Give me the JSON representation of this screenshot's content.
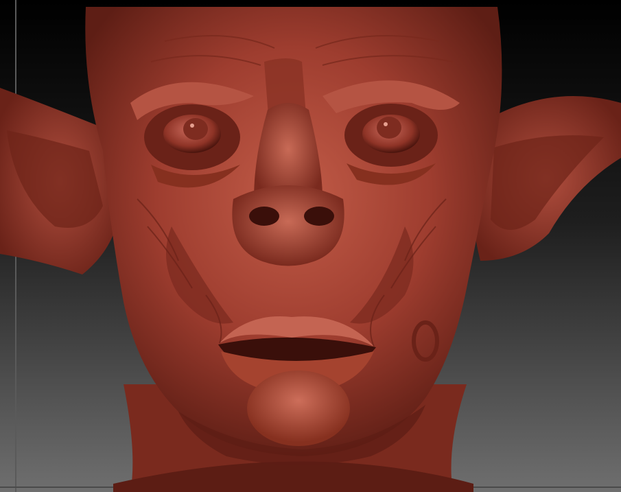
{
  "viewport": {
    "background_top": "#000000",
    "background_mid": "#1e1e1e",
    "background_bottom": "#6f6f6f"
  },
  "sculpt": {
    "subject": "goblin-head",
    "material_base": "#9b3b2e",
    "material_light": "#c05a48",
    "material_shadow": "#5c1d14",
    "material_deep": "#3a0f0a"
  }
}
